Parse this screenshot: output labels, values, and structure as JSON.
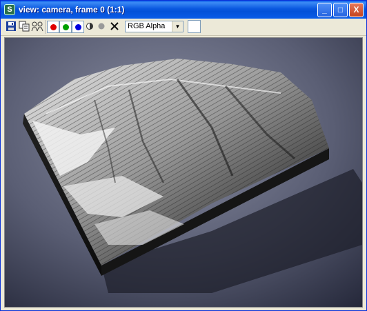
{
  "window": {
    "title": "view: camera, frame 0 (1:1)",
    "app_icon_glyph": "S",
    "minimize_glyph": "_",
    "maximize_glyph": "□",
    "close_glyph": "X"
  },
  "toolbar": {
    "buttons": [
      {
        "name": "save-icon"
      },
      {
        "name": "copy-icon"
      },
      {
        "name": "clone-window-icon"
      },
      {
        "name": "red-channel-icon",
        "color": "#e00000"
      },
      {
        "name": "green-channel-icon",
        "color": "#00a000"
      },
      {
        "name": "blue-channel-icon",
        "color": "#0000e0"
      },
      {
        "name": "monochrome-icon"
      },
      {
        "name": "alpha-channel-icon"
      },
      {
        "name": "clear-icon"
      }
    ],
    "channel_select": {
      "value": "RGB Alpha"
    },
    "color_swatch": "#ffffff"
  },
  "colors": {
    "titlebar": "#0a58e0",
    "window_bg": "#ece9d8",
    "viewport_bg": "#34374a"
  }
}
